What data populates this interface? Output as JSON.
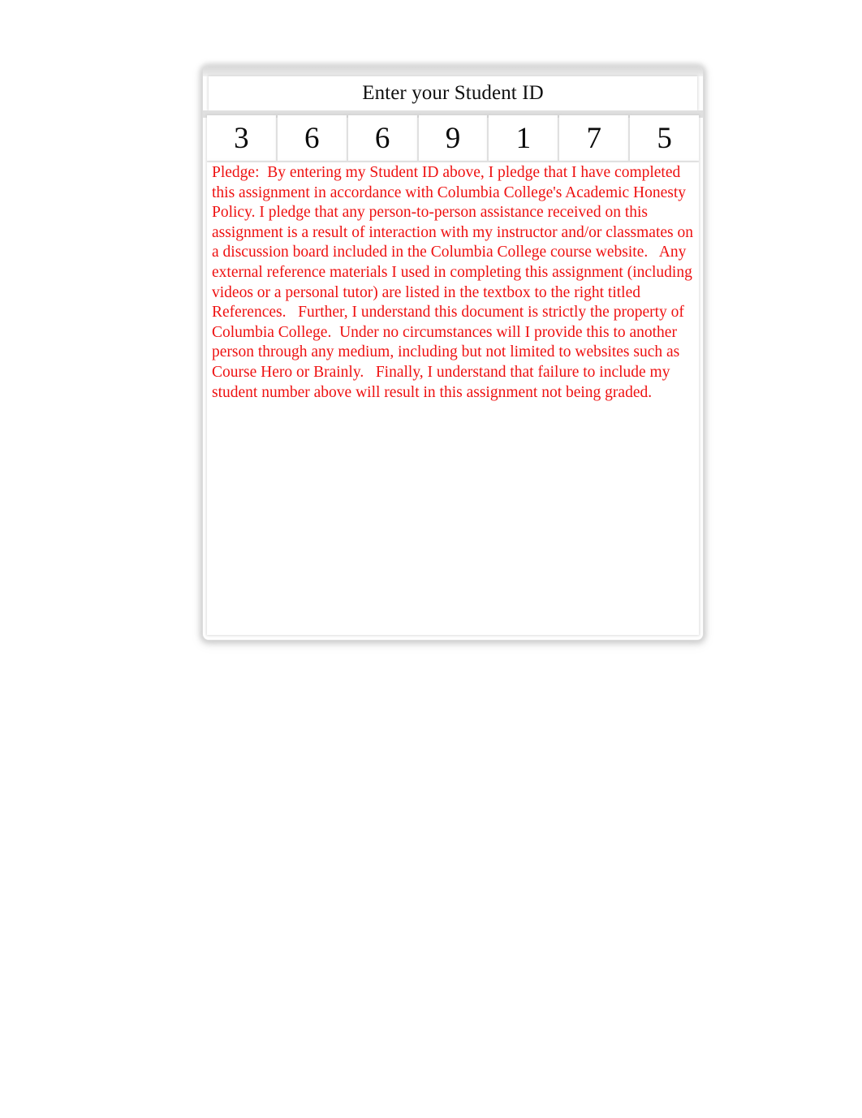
{
  "header": {
    "title": "Enter your Student ID"
  },
  "student_id": {
    "digits": [
      "3",
      "6",
      "6",
      "9",
      "1",
      "7",
      "5"
    ]
  },
  "pledge": {
    "text": "Pledge:  By entering my Student ID above, I pledge that I have completed this assignment in accordance with Columbia College's Academic Honesty Policy. I pledge that any person-to-person assistance received on this assignment is a result of interaction with my instructor and/or classmates on a discussion board included in the Columbia College course website.   Any external reference materials I used in completing this assignment (including videos or a personal tutor) are listed in the textbox to the right titled References.   Further, I understand this document is strictly the property of Columbia College.  Under no circumstances will I provide this to another person through any medium, including but not limited to websites such as Course Hero or Brainly.   Finally, I understand that failure to include my student number above will result in this assignment not being graded."
  },
  "colors": {
    "pledge_red": "#ee1111",
    "title_text": "#101010",
    "digit_text": "#0b0b0b",
    "frame_border": "#dcdcdc",
    "separator_gray": "#e0e0e0",
    "page_background": "#ffffff"
  }
}
